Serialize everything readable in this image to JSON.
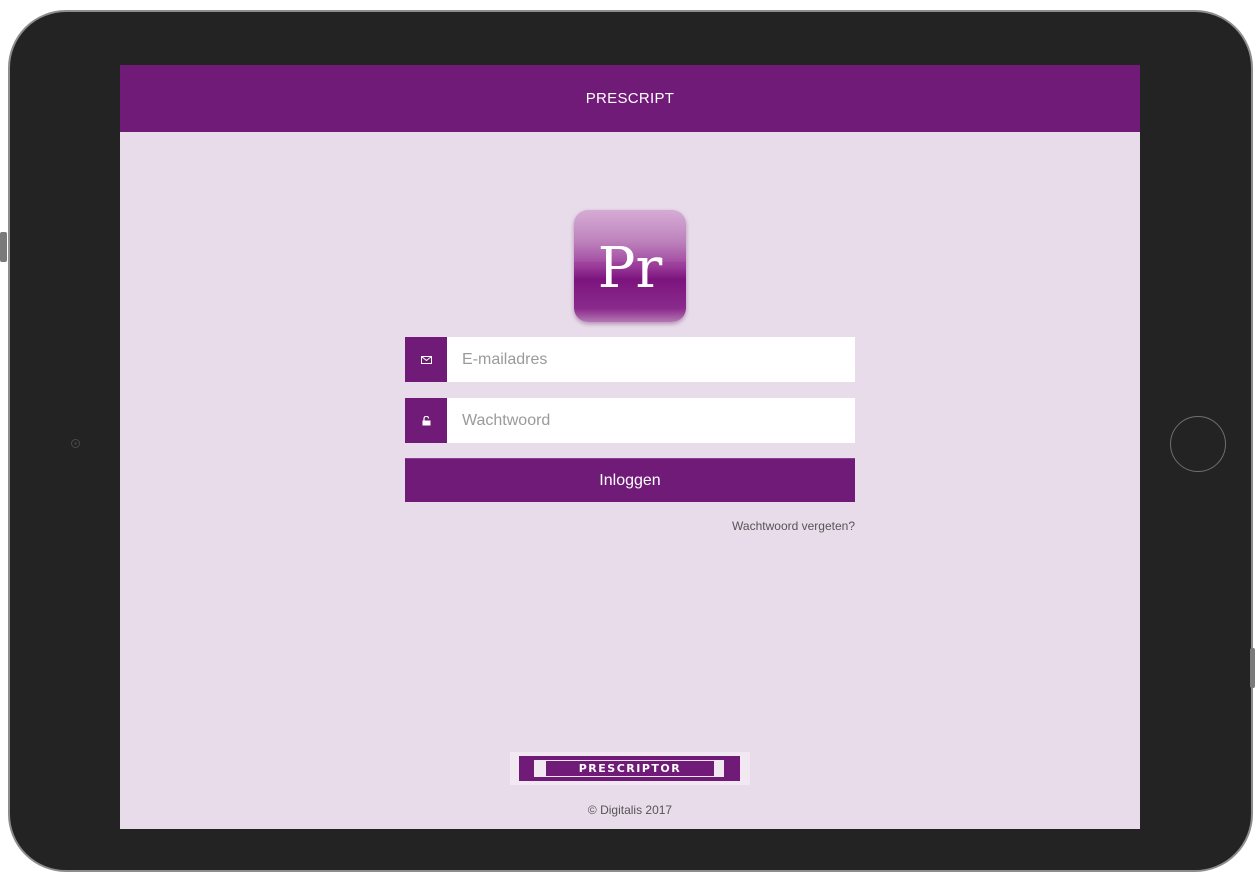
{
  "header": {
    "title": "PRESCRIPT"
  },
  "logo": {
    "text": "Pr"
  },
  "login_form": {
    "email_placeholder": "E-mailadres",
    "email_icon": "envelope-icon",
    "password_placeholder": "Wachtwoord",
    "password_icon": "lock-icon",
    "login_label": "Inloggen",
    "forgot_password_label": "Wachtwoord vergeten?"
  },
  "footer": {
    "brand_logo_text": "PRESCRIPTOR",
    "copyright": "© Digitalis 2017"
  },
  "colors": {
    "brand_purple": "#701b78",
    "page_background": "#e8dcea"
  }
}
